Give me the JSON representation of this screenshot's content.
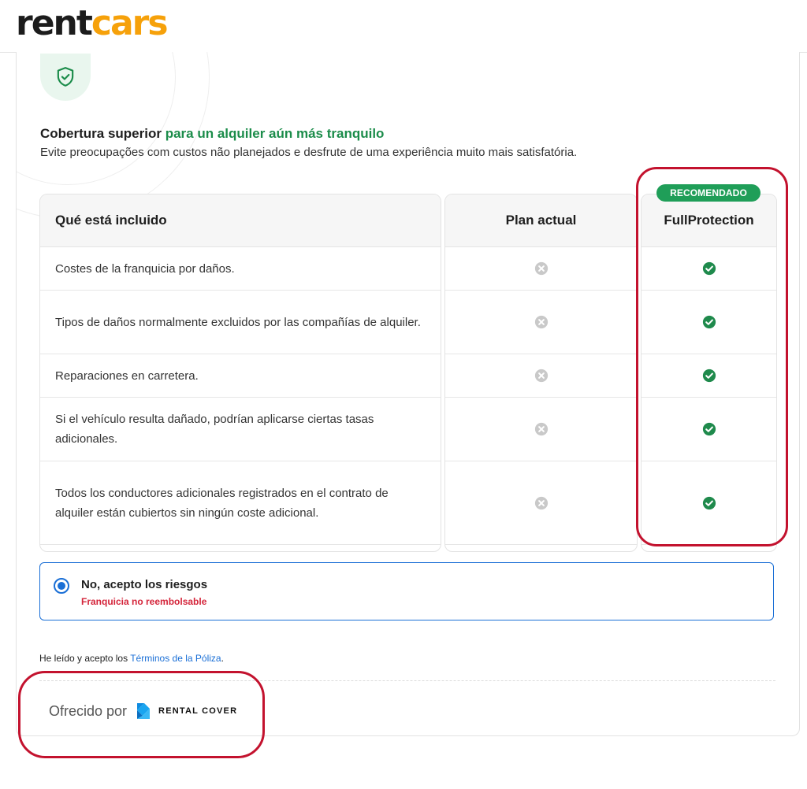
{
  "brand": {
    "logo_part1": "rent",
    "logo_part2": "cars"
  },
  "coverage": {
    "title_part1": "Cobertura superior",
    "title_highlight": "para un alquiler aún más tranquilo",
    "subtitle": "Evite preocupações com custos não planejados e desfrute de uma experiência muito mais satisfatória."
  },
  "table": {
    "col_included": "Qué está incluido",
    "col_current": "Plan actual",
    "col_full": "FullProtection",
    "badge": "RECOMENDADO",
    "rows": [
      {
        "label": "Costes de la franquicia por daños.",
        "current": "not-included-icon",
        "full": "included-icon"
      },
      {
        "label": "Tipos de daños normalmente excluidos por las compañías de alquiler.",
        "current": "not-included-icon",
        "full": "included-icon"
      },
      {
        "label": "Reparaciones en carretera.",
        "current": "not-included-icon",
        "full": "included-icon"
      },
      {
        "label": "Si el vehículo resulta dañado, podrían aplicarse ciertas tasas adicionales.",
        "current": "not-included-icon",
        "full": "included-icon"
      },
      {
        "label": "Todos los conductores adicionales registrados en el contrato de alquiler están cubiertos sin ningún coste adicional.",
        "current": "not-included-icon",
        "full": "included-icon"
      }
    ]
  },
  "option": {
    "title": "No, acepto los riesgos",
    "subtitle": "Franquicia no reembolsable",
    "selected": true
  },
  "terms": {
    "prefix": "He leído y acepto los ",
    "link": "Términos de la Póliza",
    "suffix": "."
  },
  "offered": {
    "label": "Ofrecido por",
    "provider": "RENTAL COVER"
  },
  "colors": {
    "accent_green": "#1f9e58",
    "link_blue": "#1a6fd6",
    "warning_red": "#d4243a",
    "brand_orange": "#f6a10a"
  }
}
